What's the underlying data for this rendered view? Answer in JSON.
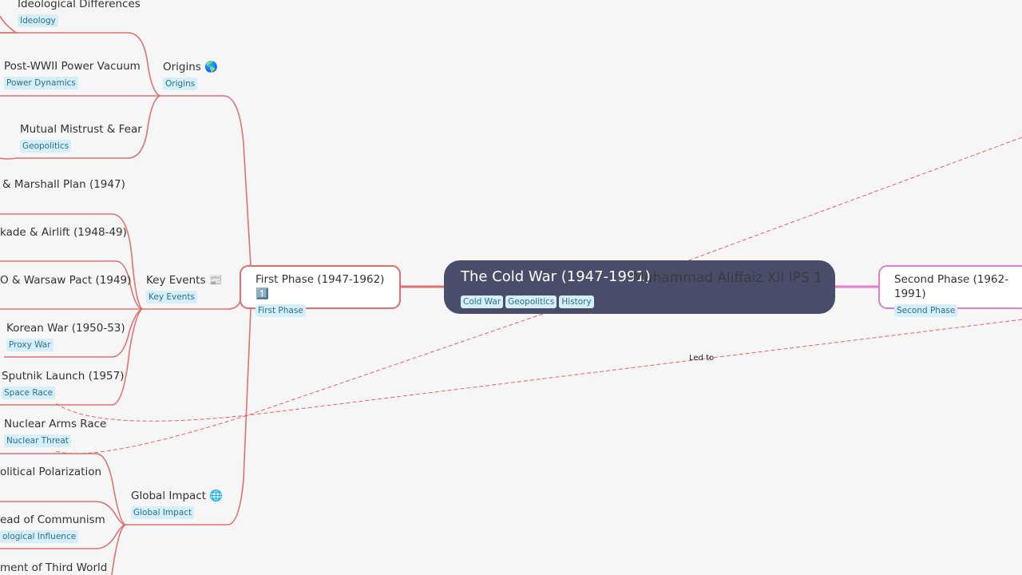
{
  "central": {
    "title": "The Cold War (1947-1991)",
    "author": "Muhammad Aliffaiz XII IPS 1",
    "tags": [
      "Cold War",
      "Geopolitics",
      "History"
    ]
  },
  "first_phase": {
    "title": "First Phase (1947-1962) 1️⃣",
    "tag": "First Phase",
    "color": "#e07070"
  },
  "second_phase": {
    "title": "Second Phase (1962-1991)",
    "tag": "Second Phase",
    "color": "#e87ccc"
  },
  "branches": {
    "origins": {
      "title": "Origins 🌎",
      "tag": "Origins",
      "children": [
        {
          "title": "Ideological Differences",
          "tag": "Ideology"
        },
        {
          "title": "Post-WWII Power Vacuum",
          "tag": "Power Dynamics"
        },
        {
          "title": "Mutual Mistrust & Fear",
          "tag": "Geopolitics"
        }
      ]
    },
    "key_events": {
      "title": "Key Events 📰",
      "tag": "Key Events",
      "children": [
        {
          "title": "& Marshall Plan (1947)"
        },
        {
          "title": "kade & Airlift (1948-49)"
        },
        {
          "title": "O & Warsaw Pact (1949)"
        },
        {
          "title": "Korean War (1950-53)",
          "tag": "Proxy War"
        },
        {
          "title": "Sputnik Launch (1957)",
          "tag": "Space Race"
        }
      ]
    },
    "global_impact": {
      "title": "Global Impact 🌐",
      "tag": "Global Impact",
      "children": [
        {
          "title": "Nuclear Arms Race",
          "tag": "Nuclear Threat"
        },
        {
          "title": "olitical Polarization"
        },
        {
          "title": "ead of Communism",
          "tag": "ological Influence"
        },
        {
          "title": "ment of Third World"
        }
      ]
    }
  },
  "relations": [
    {
      "label": "Led to"
    }
  ]
}
